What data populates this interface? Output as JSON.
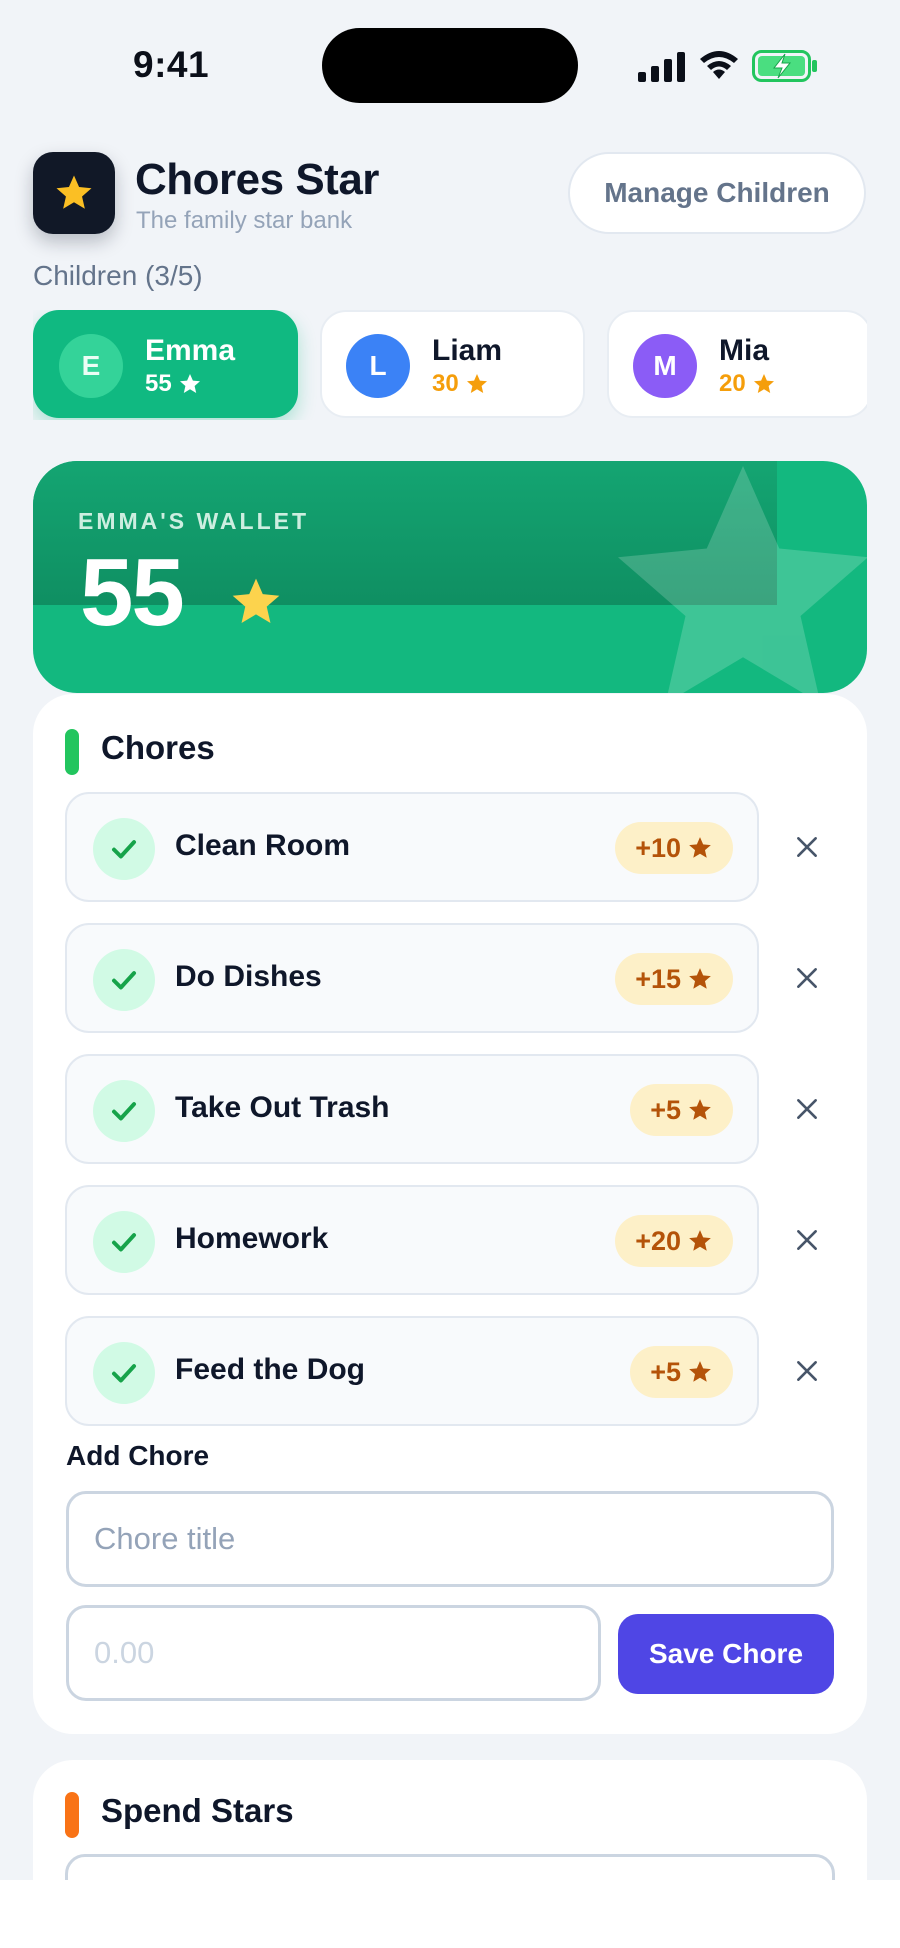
{
  "status_bar": {
    "time": "9:41"
  },
  "header": {
    "title": "Chores Star",
    "subtitle": "The family star bank",
    "manage_button": "Manage Children"
  },
  "children": {
    "label": "Children (3/5)",
    "items": [
      {
        "initial": "E",
        "name": "Emma",
        "stars": "55",
        "color": "#34d399",
        "active": true
      },
      {
        "initial": "L",
        "name": "Liam",
        "stars": "30",
        "color": "#3b82f6",
        "active": false
      },
      {
        "initial": "M",
        "name": "Mia",
        "stars": "20",
        "color": "#8b5cf6",
        "active": false
      }
    ]
  },
  "wallet": {
    "label": "EMMA'S WALLET",
    "amount": "55"
  },
  "chores": {
    "title": "Chores",
    "items": [
      {
        "title": "Clean Room",
        "reward": "+10"
      },
      {
        "title": "Do Dishes",
        "reward": "+15"
      },
      {
        "title": "Take Out Trash",
        "reward": "+5"
      },
      {
        "title": "Homework",
        "reward": "+20"
      },
      {
        "title": "Feed the Dog",
        "reward": "+5"
      }
    ],
    "add_label": "Add Chore",
    "title_placeholder": "Chore title",
    "amount_placeholder": "0.00",
    "save_button": "Save Chore"
  },
  "spend": {
    "title": "Spend Stars"
  },
  "colors": {
    "accent_green": "#10b981",
    "primary_indigo": "#4f46e5",
    "star_gold": "#f59e0b",
    "spend_orange": "#f97316"
  }
}
